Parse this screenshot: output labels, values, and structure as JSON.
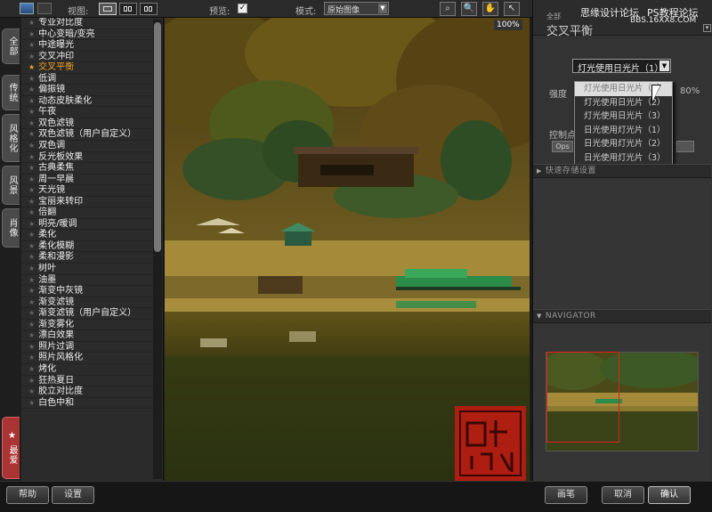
{
  "toolbar": {
    "view_label": "视图:",
    "preview_label": "预览:",
    "preview_checked": "✓",
    "mode_label": "模式:",
    "mode_value": "原始图像",
    "zoom": "100%"
  },
  "left_tabs": [
    {
      "label": "全部"
    },
    {
      "label": "传统"
    },
    {
      "label": "风格化"
    },
    {
      "label": "风景"
    },
    {
      "label": "肖像"
    }
  ],
  "favorites_tab": {
    "star": "★",
    "label": "最爱"
  },
  "filters": [
    "专业对比度",
    "中心变暗/变亮",
    "中途曝光",
    "交叉冲印",
    "交叉平衡",
    "低调",
    "偏振镜",
    "动态皮肤柔化",
    "午夜",
    "双色滤镜",
    "双色滤镜（用户自定义）",
    "双色调",
    "反光板效果",
    "古典柔焦",
    "周一早晨",
    "天光镜",
    "宝丽来转印",
    "倍翻",
    "明亮/暖调",
    "柔化",
    "柔化模糊",
    "柔和漫影",
    "树叶",
    "油墨",
    "渐变中灰镜",
    "渐变滤镜",
    "渐变滤镜（用户自定义）",
    "渐变雾化",
    "漂白效果",
    "照片过调",
    "照片风格化",
    "烤化",
    "狂热夏日",
    "胶立对比度",
    "白色中和"
  ],
  "selected_filter_index": 4,
  "right_panel": {
    "small_label": "全部",
    "title": "交叉平衡",
    "watermark_1": "思缘设计论坛",
    "watermark_2": "PS教程论坛",
    "watermark_3": "BBS.16XX8.COM",
    "select_value": "灯光使用日光片（1）",
    "dropdown_options": [
      "灯光使用日光片（1）",
      "灯光使用日光片（2）",
      "灯光使用日光片（3）",
      "日光使用灯光片（1）",
      "日光使用灯光片（2）",
      "日光使用灯光片（3）"
    ],
    "strength_label": "强度",
    "strength_value": "80%",
    "control_label": "控制点",
    "control_btn": "Ops",
    "quick_section": "快速存储设置",
    "navigator_section": "NAVIGATOR"
  },
  "bottom": {
    "help": "帮助",
    "settings": "设置",
    "brush": "画笔",
    "cancel": "取消",
    "ok": "确认"
  },
  "colors": {
    "accent": "#f3a021",
    "favorites": "#a33333",
    "navigator_box": "#e02020"
  }
}
